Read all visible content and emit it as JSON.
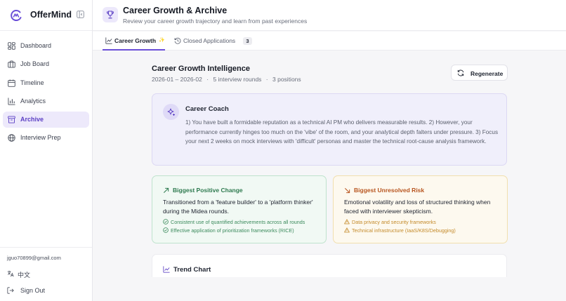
{
  "app": {
    "name": "OfferMind"
  },
  "sidebar": {
    "items": [
      {
        "label": "Dashboard",
        "icon": "dashboard-icon",
        "active": false
      },
      {
        "label": "Job Board",
        "icon": "briefcase-icon",
        "active": false
      },
      {
        "label": "Timeline",
        "icon": "calendar-icon",
        "active": false
      },
      {
        "label": "Analytics",
        "icon": "bar-chart-icon",
        "active": false
      },
      {
        "label": "Archive",
        "icon": "archive-icon",
        "active": true
      },
      {
        "label": "Interview Prep",
        "icon": "globe-icon",
        "active": false
      }
    ],
    "email": "jguo70899@gmail.com",
    "language": "中文",
    "sign_out": "Sign Out"
  },
  "header": {
    "title": "Career Growth & Archive",
    "subtitle": "Review your career growth trajectory and learn from past experiences"
  },
  "tabs": [
    {
      "label": "Career Growth",
      "active": true,
      "sparkle": "✨"
    },
    {
      "label": "Closed Applications",
      "active": false,
      "count": "3"
    }
  ],
  "main": {
    "title": "Career Growth Intelligence",
    "meta": {
      "range": "2026-01 – 2026-02",
      "rounds": "5 interview rounds",
      "positions": "3 positions",
      "separator": "·"
    },
    "regenerate_label": "Regenerate",
    "coach": {
      "title": "Career Coach",
      "text": "1) You have built a formidable reputation as a technical AI PM who delivers measurable results. 2) However, your performance currently hinges too much on the 'vibe' of the room, and your analytical depth falters under pressure. 3) Focus your next 2 weeks on mock interviews with 'difficult' personas and master the technical root-cause analysis framework."
    },
    "positive": {
      "heading": "Biggest Positive Change",
      "body": "Transitioned from a 'feature builder' to a 'platform thinker' during the Midea rounds.",
      "items": [
        "Consistent use of quantified achievements across all rounds",
        "Effective application of prioritization frameworks (RICE)"
      ]
    },
    "risk": {
      "heading": "Biggest Unresolved Risk",
      "body": "Emotional volatility and loss of structured thinking when faced with interviewer skepticism.",
      "items": [
        "Data privacy and security frameworks",
        "Technical infrastructure (IaaS/K8S/Debugging)"
      ]
    },
    "trend": {
      "title": "Trend Chart"
    }
  },
  "colors": {
    "accent": "#6b4fd8",
    "positive": "#2e7a4f",
    "risk": "#b8551f",
    "warning": "#c48a2a"
  }
}
